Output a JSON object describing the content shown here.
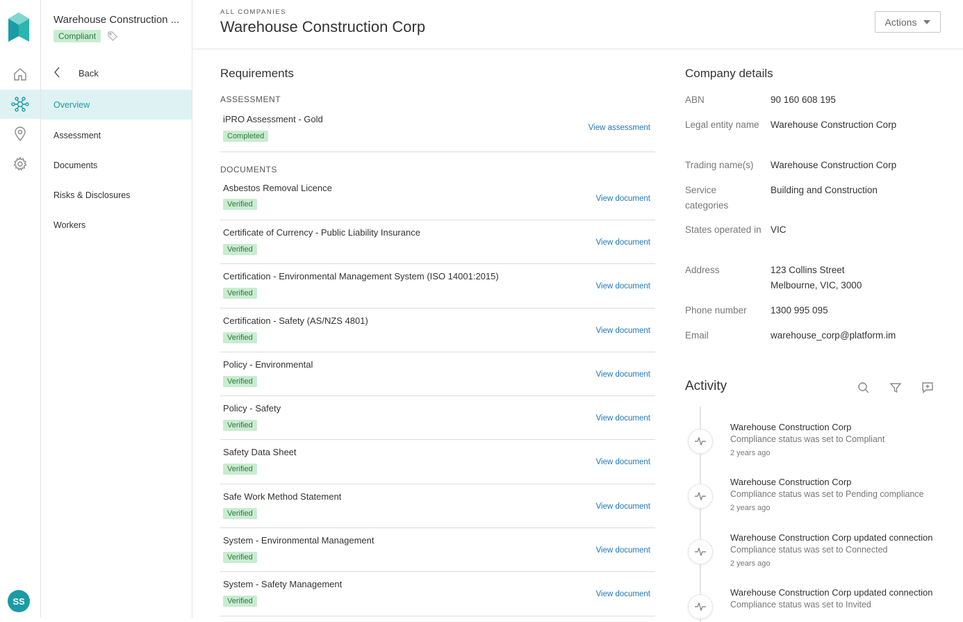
{
  "sidebar_rail": {
    "avatar_initials": "SS",
    "icons": [
      "home-icon",
      "network-icon",
      "location-pin-icon",
      "gear-icon"
    ],
    "accent": "#1a9ba5"
  },
  "company_panel": {
    "name": "Warehouse Construction ...",
    "status": "Compliant",
    "back_label": "Back",
    "nav": [
      "Overview",
      "Assessment",
      "Documents",
      "Risks & Disclosures",
      "Workers"
    ]
  },
  "header": {
    "breadcrumb": "ALL COMPANIES",
    "title": "Warehouse Construction Corp",
    "actions_label": "Actions"
  },
  "requirements": {
    "title": "Requirements",
    "assessment_heading": "ASSESSMENT",
    "assessment": {
      "name": "iPRO Assessment - Gold",
      "status": "Completed",
      "link": "View assessment"
    },
    "documents_heading": "DOCUMENTS",
    "documents": [
      {
        "name": "Asbestos Removal Licence",
        "status": "Verified",
        "link": "View document"
      },
      {
        "name": "Certificate of Currency - Public Liability Insurance",
        "status": "Verified",
        "link": "View document"
      },
      {
        "name": "Certification - Environmental Management System (ISO 14001:2015)",
        "status": "Verified",
        "link": "View document"
      },
      {
        "name": "Certification - Safety (AS/NZS 4801)",
        "status": "Verified",
        "link": "View document"
      },
      {
        "name": "Policy - Environmental",
        "status": "Verified",
        "link": "View document"
      },
      {
        "name": "Policy - Safety",
        "status": "Verified",
        "link": "View document"
      },
      {
        "name": "Safety Data Sheet",
        "status": "Verified",
        "link": "View document"
      },
      {
        "name": "Safe Work Method Statement",
        "status": "Verified",
        "link": "View document"
      },
      {
        "name": "System - Environmental Management",
        "status": "Verified",
        "link": "View document"
      },
      {
        "name": "System - Safety Management",
        "status": "Verified",
        "link": "View document"
      }
    ]
  },
  "company_details": {
    "title": "Company details",
    "fields": [
      {
        "label": "ABN",
        "value": "90 160 608 195"
      },
      {
        "label": "Legal entity name",
        "value": "Warehouse Construction Corp"
      },
      {
        "label": "Trading name(s)",
        "value": "Warehouse Construction Corp"
      },
      {
        "label": "Service categories",
        "value": "Building and Construction"
      },
      {
        "label": "States operated in",
        "value": "VIC"
      },
      {
        "label": "Address",
        "value": "123 Collins Street",
        "value2": "Melbourne, VIC, 3000"
      },
      {
        "label": "Phone number",
        "value": "1300 995 095"
      },
      {
        "label": "Email",
        "value": "warehouse_corp@platform.im"
      }
    ]
  },
  "activity": {
    "title": "Activity",
    "items": [
      {
        "title": "Warehouse Construction Corp",
        "desc": "Compliance status was set to Compliant",
        "when": "2 years ago"
      },
      {
        "title": "Warehouse Construction Corp",
        "desc": "Compliance status was set to Pending compliance",
        "when": "2 years ago"
      },
      {
        "title": "Warehouse Construction Corp updated connection",
        "desc": "Compliance status was set to Connected",
        "when": "2 years ago"
      },
      {
        "title": "Warehouse Construction Corp updated connection",
        "desc": "Compliance status was set to Invited",
        "when": ""
      }
    ]
  }
}
